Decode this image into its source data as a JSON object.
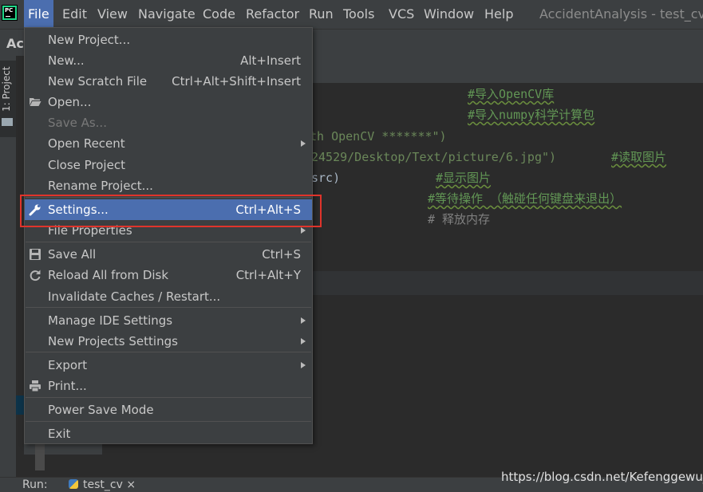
{
  "app": {
    "logo_text": "PC",
    "window_title": "AccidentAnalysis - test_cv.py"
  },
  "menubar": [
    "File",
    "Edit",
    "View",
    "Navigate",
    "Code",
    "Refactor",
    "Run",
    "Tools",
    "VCS",
    "Window",
    "Help"
  ],
  "navbar": {
    "project_label": "Acc"
  },
  "side_panel": {
    "project_tab": "1: Project"
  },
  "file_menu": {
    "items": [
      {
        "label": "New Project...",
        "shortcut": ""
      },
      {
        "label": "New...",
        "shortcut": "Alt+Insert"
      },
      {
        "label": "New Scratch File",
        "shortcut": "Ctrl+Alt+Shift+Insert"
      },
      {
        "label": "Open...",
        "shortcut": "",
        "icon": "open-folder-icon"
      },
      {
        "label": "Save As...",
        "shortcut": "",
        "disabled": true
      },
      {
        "label": "Open Recent",
        "shortcut": "",
        "submenu": true
      },
      {
        "label": "Close Project",
        "shortcut": ""
      },
      {
        "label": "Rename Project...",
        "shortcut": ""
      },
      {
        "label": "Settings...",
        "shortcut": "Ctrl+Alt+S",
        "icon": "wrench-icon",
        "selected": true
      },
      {
        "label": "File Properties",
        "shortcut": "",
        "submenu": true
      },
      {
        "label": "Save All",
        "shortcut": "Ctrl+S",
        "icon": "save-icon"
      },
      {
        "label": "Reload All from Disk",
        "shortcut": "Ctrl+Alt+Y",
        "icon": "reload-icon"
      },
      {
        "label": "Invalidate Caches / Restart...",
        "shortcut": ""
      },
      {
        "label": "Manage IDE Settings",
        "shortcut": "",
        "submenu": true
      },
      {
        "label": "New Projects Settings",
        "shortcut": "",
        "submenu": true
      },
      {
        "label": "Export",
        "shortcut": "",
        "submenu": true
      },
      {
        "label": "Print...",
        "shortcut": "",
        "icon": "printer-icon"
      },
      {
        "label": "Power Save Mode",
        "shortcut": ""
      },
      {
        "label": "Exit",
        "shortcut": ""
      }
    ]
  },
  "editor": {
    "lines": [
      {
        "comment": "#导入OpenCV库"
      },
      {
        "comment": "#导入numpy科学计算包"
      },
      {
        "code": "th OpenCV *******\")"
      },
      {
        "code": "24529/Desktop/Text/picture/6.jpg\")",
        "comment": "#读取图片"
      },
      {
        "code": "src)",
        "comment": "#显示图片"
      },
      {
        "comment": "#等待操作 （触碰任何键盘来退出）"
      },
      {
        "comment": "# 释放内存"
      }
    ]
  },
  "run_bar": {
    "label": "Run:",
    "tab": "test_cv",
    "close": "×"
  },
  "watermark": "https://blog.csdn.net/Kefenggewu_",
  "colors": {
    "menu_bg": "#3c3f41",
    "selection": "#4b6eaf",
    "highlight_box": "#e0342b",
    "editor_bg": "#2b2b2b"
  }
}
